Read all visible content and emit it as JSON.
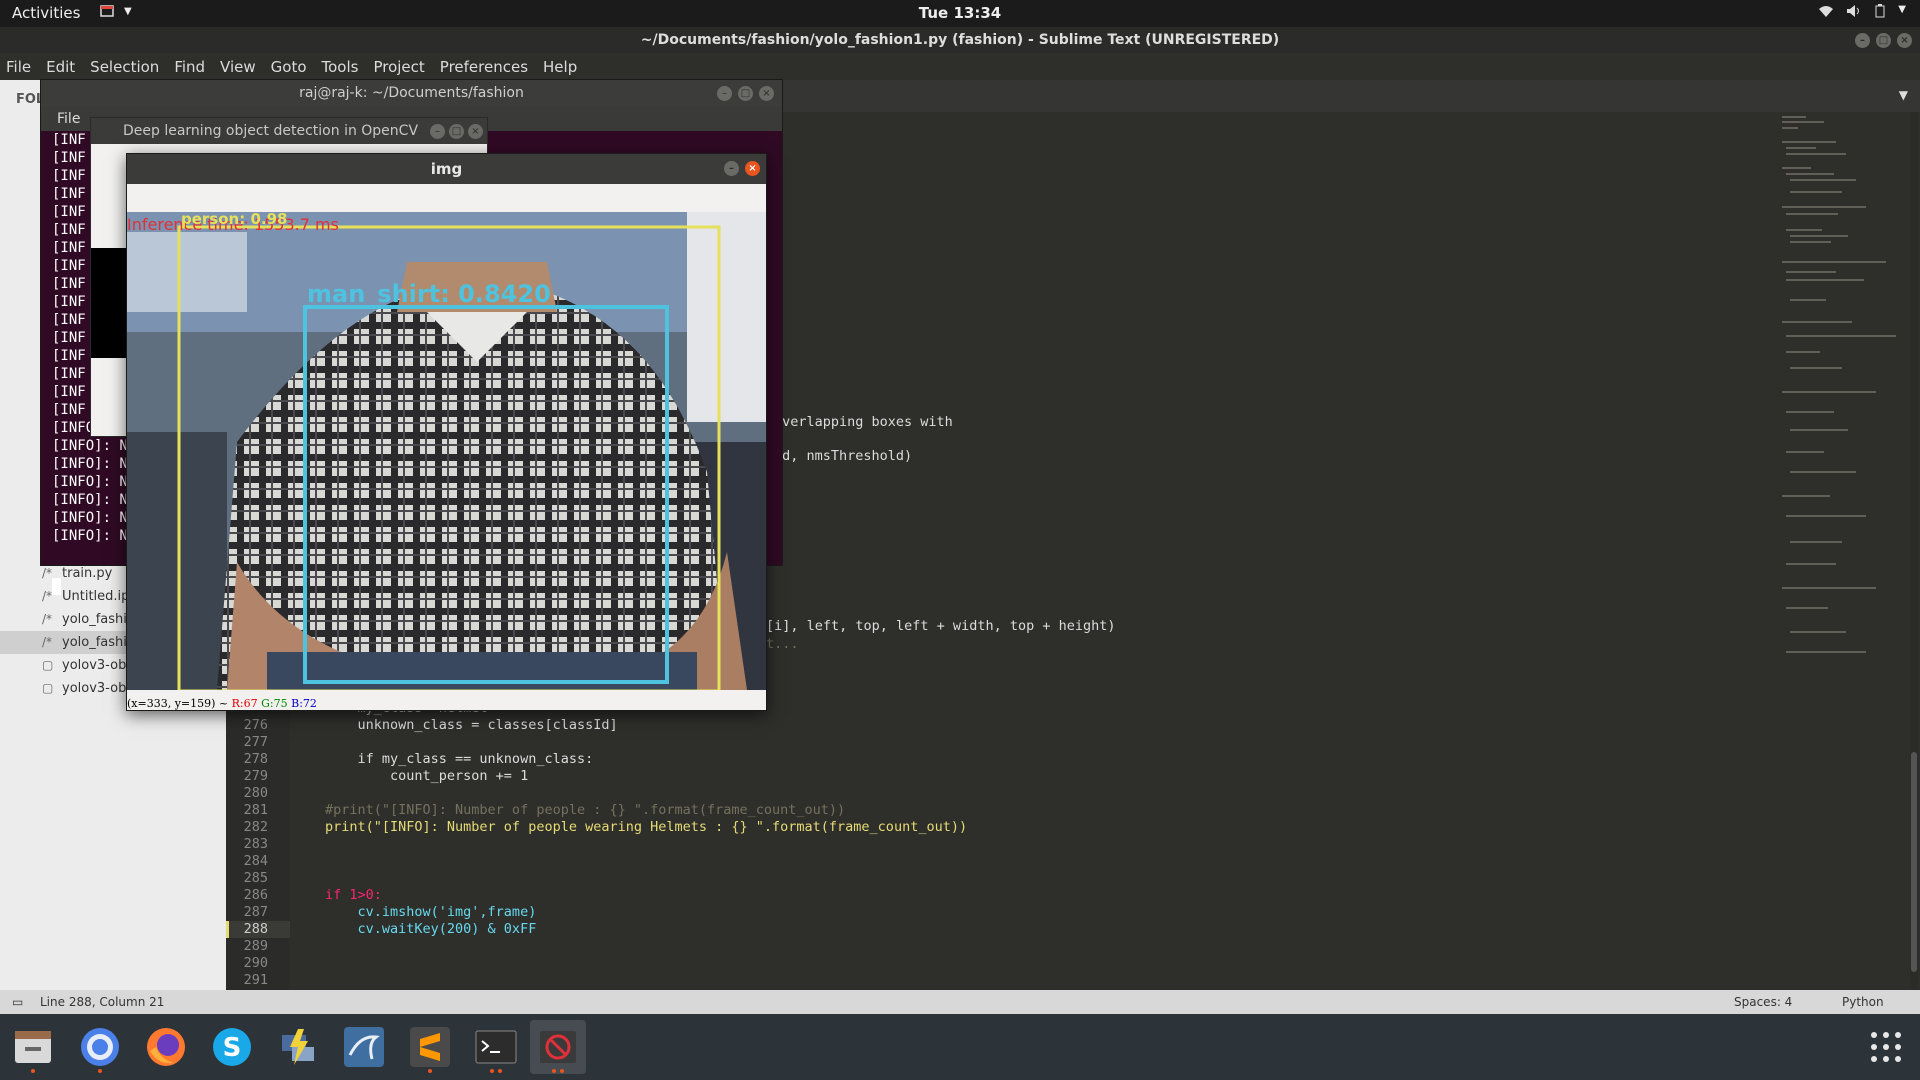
{
  "topbar": {
    "activities": "Activities",
    "clock": "Tue 13:34"
  },
  "sublime": {
    "title": "~/Documents/fashion/yolo_fashion1.py (fashion) - Sublime Text (UNREGISTERED)",
    "menu": [
      "File",
      "Edit",
      "Selection",
      "Find",
      "View",
      "Goto",
      "Tools",
      "Project",
      "Preferences",
      "Help"
    ],
    "sidebar": {
      "folders_label": "FOLD",
      "files": [
        "train.py",
        "Untitled.ip",
        "yolo_fashio",
        "yolo_fashio",
        "yolov3-obj",
        "yolov3-obj"
      ]
    },
    "fragments": {
      "overlap": "overlapping boxes with",
      "nms": "ld, nmsThreshold)",
      "draw": "[i], left, top, left + width, top + height)",
      "dots": "t..."
    },
    "code": [
      {
        "num": "",
        "text": "    my_class='helmet'"
      },
      {
        "num": "276",
        "text": "    unknown_class = classes[classId]"
      },
      {
        "num": "277",
        "text": ""
      },
      {
        "num": "278",
        "text": "    if my_class == unknown_class:"
      },
      {
        "num": "279",
        "text": "        count_person += 1"
      },
      {
        "num": "280",
        "text": ""
      },
      {
        "num": "281",
        "text": "#print(\"[INFO]: Number of people : {} \".format(frame_count_out))"
      },
      {
        "num": "282",
        "text": "print(\"[INFO]: Number of people wearing Helmets : {} \".format(frame_count_out))"
      },
      {
        "num": "283",
        "text": ""
      },
      {
        "num": "284",
        "text": ""
      },
      {
        "num": "285",
        "text": ""
      },
      {
        "num": "286",
        "text": "if 1>0:"
      },
      {
        "num": "287",
        "text": "    cv.imshow('img',frame)"
      },
      {
        "num": "288",
        "text": "    cv.waitKey(200) & 0xFF"
      },
      {
        "num": "289",
        "text": ""
      },
      {
        "num": "290",
        "text": ""
      },
      {
        "num": "291",
        "text": ""
      }
    ],
    "status": {
      "position": "Line 288, Column 21",
      "spaces": "Spaces: 4",
      "syntax": "Python"
    }
  },
  "terminal": {
    "title": "raj@raj-k: ~/Documents/fashion",
    "menu": "File",
    "lines": [
      "[INF",
      "[INF",
      "[INF",
      "[INF",
      "[INF",
      "[INF",
      "[INF",
      "[INF",
      "[INF",
      "[INF",
      "[INF",
      "[INF",
      "[INF",
      "[INF",
      "[INF",
      "[INF",
      "[INFO]: N",
      "[INFO]: N",
      "[INFO]: N",
      "[INFO]: N",
      "[INFO]: N",
      "[INFO]: N",
      "[INFO]: N"
    ]
  },
  "dl_window": {
    "title": "Deep learning object detection in OpenCV"
  },
  "img_window": {
    "title": "img",
    "inference": "Inference time: 1553.7 ms",
    "detections": [
      {
        "label": "person: 0.98",
        "color": "#e6e05a"
      },
      {
        "label": "man_shirt: 0.8420",
        "color": "#4ec3e0"
      }
    ],
    "pixel_status": {
      "coords": "(x=333, y=159) ~",
      "r": "R:67",
      "g": "G:75",
      "b": "B:72"
    }
  },
  "dock": {
    "apps": [
      "files-icon",
      "chrome-icon",
      "firefox-icon",
      "skype-icon",
      "network-tool-icon",
      "mysql-workbench-icon",
      "sublime-text-icon",
      "terminal-icon",
      "stop-icon",
      "show-apps-icon"
    ]
  },
  "colors": {
    "keyword": "#f92672",
    "string": "#e6db74",
    "function": "#66d9ef",
    "number": "#ae81ff",
    "comment": "#75715e",
    "ubuntu_orange": "#e95420"
  }
}
